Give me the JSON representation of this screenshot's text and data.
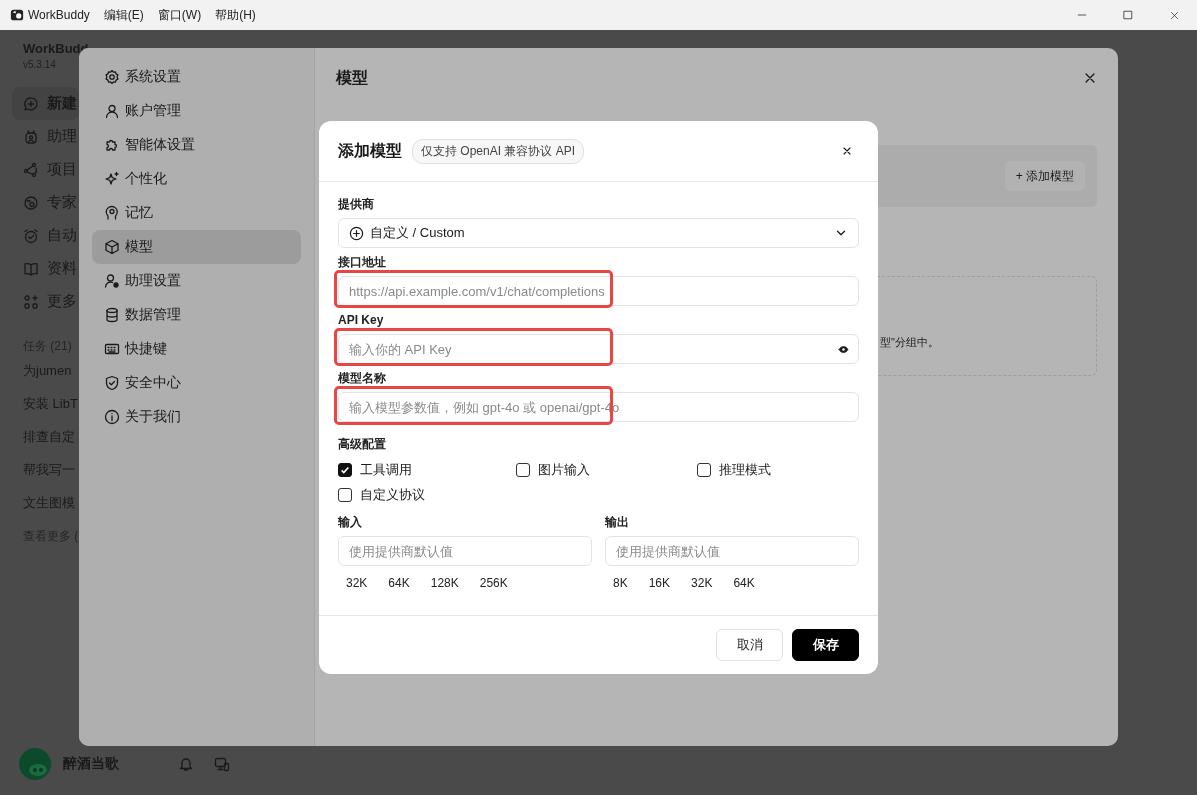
{
  "titlebar": {
    "app_name": "WorkBuddy",
    "menus": [
      "编辑(E)",
      "窗口(W)",
      "帮助(H)"
    ]
  },
  "sidebar": {
    "app_title": "WorkBudd",
    "version": "v5.3.14",
    "nav": [
      {
        "label": "新建",
        "selected": true
      },
      {
        "label": "助理",
        "selected": false
      },
      {
        "label": "项目",
        "selected": false
      },
      {
        "label": "专家",
        "selected": false
      },
      {
        "label": "自动",
        "selected": false
      },
      {
        "label": "资料",
        "selected": false
      },
      {
        "label": "更多",
        "selected": false
      }
    ],
    "tasks_header": "任务 (21)",
    "tasks": [
      "为jumen",
      "安装 LibT",
      "排查自定",
      "帮我写一",
      "文生图模"
    ],
    "see_more": "查看更多 (",
    "user_name": "醉酒当歌"
  },
  "settings": {
    "nav": [
      {
        "label": "系统设置",
        "selected": false
      },
      {
        "label": "账户管理",
        "selected": false
      },
      {
        "label": "智能体设置",
        "selected": false
      },
      {
        "label": "个性化",
        "selected": false
      },
      {
        "label": "记忆",
        "selected": false
      },
      {
        "label": "模型",
        "selected": true
      },
      {
        "label": "助理设置",
        "selected": false
      },
      {
        "label": "数据管理",
        "selected": false
      },
      {
        "label": "快捷键",
        "selected": false
      },
      {
        "label": "安全中心",
        "selected": false
      },
      {
        "label": "关于我们",
        "selected": false
      }
    ],
    "title": "模型",
    "add_button": "+ 添加模型",
    "hint_fragment": "型\"分组中。"
  },
  "dialog": {
    "title": "添加模型",
    "badge": "仅支持 OpenAI 兼容协议 API",
    "provider": {
      "label": "提供商",
      "value": "自定义 / Custom"
    },
    "endpoint": {
      "label": "接口地址",
      "placeholder": "https://api.example.com/v1/chat/completions",
      "highlighted": true
    },
    "api_key": {
      "label": "API Key",
      "placeholder": "输入你的 API Key",
      "highlighted": true
    },
    "model_name": {
      "label": "模型名称",
      "placeholder": "输入模型参数值，例如 gpt-4o 或 openai/gpt-4o",
      "highlighted": true
    },
    "advanced": {
      "label": "高级配置",
      "options": [
        {
          "label": "工具调用",
          "checked": true
        },
        {
          "label": "图片输入",
          "checked": false
        },
        {
          "label": "推理模式",
          "checked": false
        },
        {
          "label": "自定义协议",
          "checked": false
        }
      ]
    },
    "input_limit": {
      "label": "输入",
      "placeholder": "使用提供商默认值",
      "presets": [
        "32K",
        "64K",
        "128K",
        "256K"
      ]
    },
    "output_limit": {
      "label": "输出",
      "placeholder": "使用提供商默认值",
      "presets": [
        "8K",
        "16K",
        "32K",
        "64K"
      ]
    },
    "buttons": {
      "cancel": "取消",
      "save": "保存"
    }
  }
}
